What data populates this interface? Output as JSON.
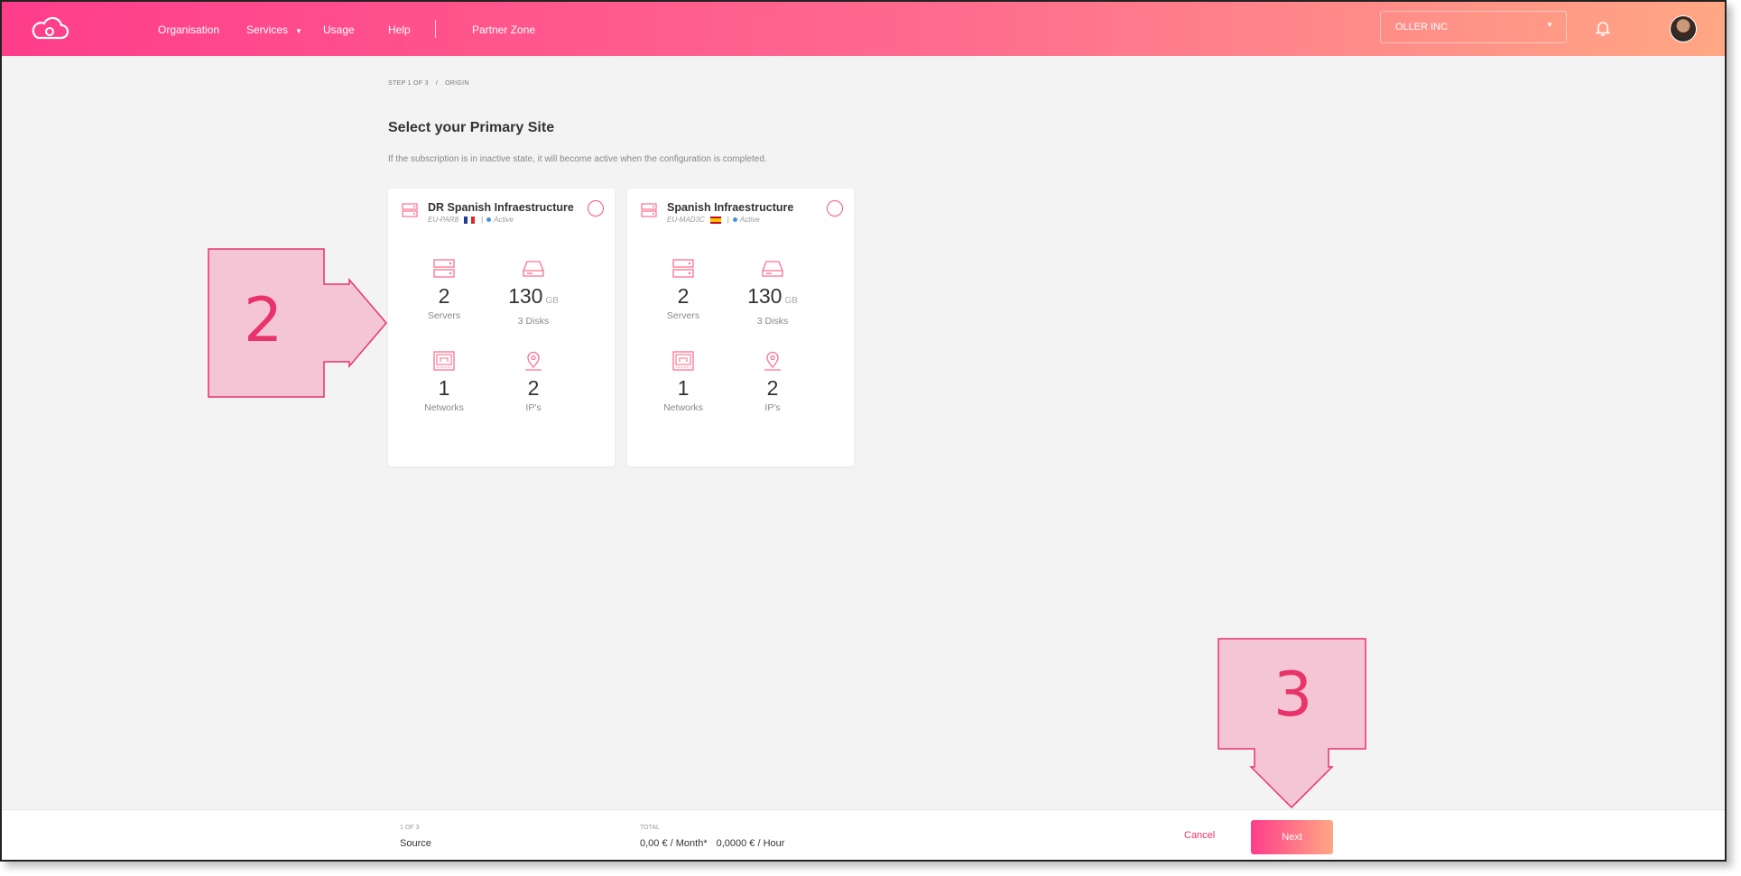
{
  "header": {
    "nav": {
      "organisation": "Organisation",
      "services": "Services",
      "usage": "Usage",
      "help": "Help",
      "partner_zone": "Partner Zone"
    },
    "org_select": {
      "value": "OLLER INC"
    },
    "icons": {
      "logo": "cloud-icon",
      "notifications": "bell-icon",
      "services_caret": "caret-down-icon"
    }
  },
  "breadcrumb": {
    "step": "STEP 1 OF 3",
    "separator": "/",
    "current": "ORIGIN"
  },
  "page": {
    "title": "Select your Primary Site",
    "subtitle": "If the subscription is in inactive state, it will become active when the configuration is completed."
  },
  "sites": [
    {
      "name": "DR Spanish Infraestructure",
      "code": "EU-PAR8",
      "flag": "france-flag",
      "status": "Active",
      "servers": {
        "value": "2",
        "label": "Servers"
      },
      "storage": {
        "value": "130",
        "unit": "GB",
        "label": "3 Disks"
      },
      "networks": {
        "value": "1",
        "label": "Networks"
      },
      "ips": {
        "value": "2",
        "label": "IP's"
      }
    },
    {
      "name": "Spanish Infraestructure",
      "code": "EU-MAD3C",
      "flag": "spain-flag",
      "status": "Active",
      "servers": {
        "value": "2",
        "label": "Servers"
      },
      "storage": {
        "value": "130",
        "unit": "GB",
        "label": "3 Disks"
      },
      "networks": {
        "value": "1",
        "label": "Networks"
      },
      "ips": {
        "value": "2",
        "label": "IP's"
      }
    }
  ],
  "annotations": {
    "step2": "2",
    "step3": "3"
  },
  "footer": {
    "step_small": "1 OF 3",
    "step": "Source",
    "total_small": "TOTAL",
    "total_month": "0,00 € / Month*",
    "total_hour": "0,0000 € / Hour",
    "cancel": "Cancel",
    "next": "Next"
  },
  "colors": {
    "accent": "#ff3d8b",
    "accent_end": "#ffa784",
    "callout": "#e8336b",
    "status_active": "#4a90d9"
  }
}
